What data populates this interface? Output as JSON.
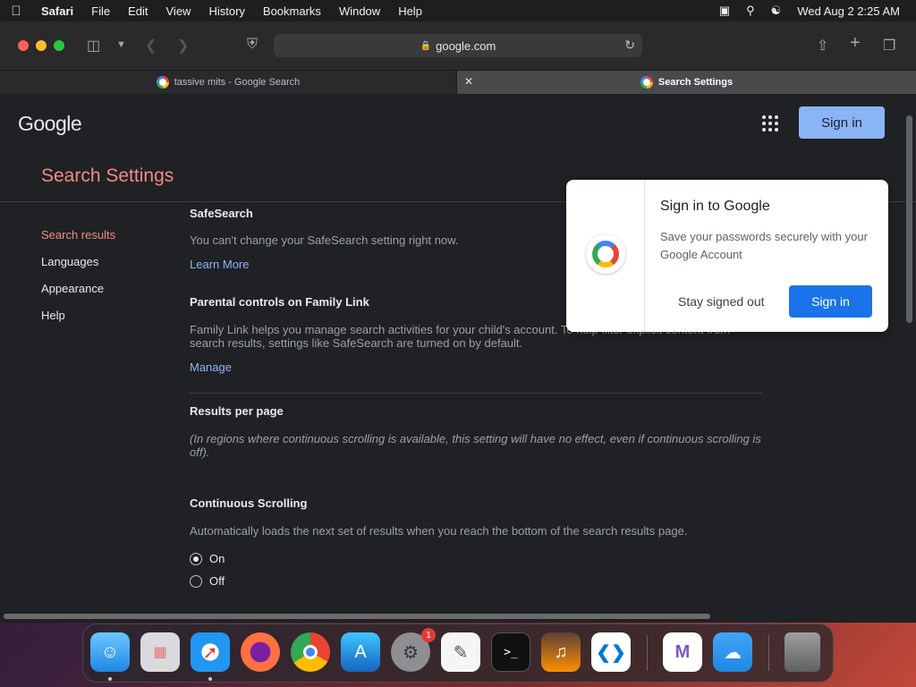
{
  "menubar": {
    "app": "Safari",
    "items": [
      "File",
      "Edit",
      "View",
      "History",
      "Bookmarks",
      "Window",
      "Help"
    ],
    "clock": "Wed Aug 2  2:25 AM"
  },
  "browser": {
    "address": "google.com",
    "tabs": [
      {
        "label": "tassive mits - Google Search",
        "active": false
      },
      {
        "label": "Search Settings",
        "active": true
      }
    ]
  },
  "page": {
    "logo": "Google",
    "signin_label": "Sign in",
    "title": "Search Settings",
    "nav": [
      "Search results",
      "Languages",
      "Appearance",
      "Help"
    ],
    "safesearch": {
      "heading": "SafeSearch",
      "text": "You can't change your SafeSearch setting right now.",
      "link": "Learn More"
    },
    "parental": {
      "heading": "Parental controls on Family Link",
      "text": "Family Link helps you manage search activities for your child's account. To help filter explicit content from search results, settings like SafeSearch are turned on by default.",
      "link": "Manage"
    },
    "results_per_page": {
      "heading": "Results per page",
      "text": "(In regions where continuous scrolling is available, this setting will have no effect, even if continuous scrolling is off)."
    },
    "continuous": {
      "heading": "Continuous Scrolling",
      "text": "Automatically loads the next set of results when you reach the bottom of the search results page.",
      "options": [
        "On",
        "Off"
      ],
      "selected": "On"
    }
  },
  "popup": {
    "title": "Sign in to Google",
    "desc": "Save your passwords securely with your Google Account",
    "stay": "Stay signed out",
    "signin": "Sign in"
  },
  "dock": {
    "badge_count": "1",
    "apps": [
      "finder-icon",
      "launchpad-icon",
      "safari-icon",
      "firefox-icon",
      "chrome-icon",
      "app-store-icon",
      "system-settings-icon",
      "textedit-icon",
      "terminal-icon",
      "garageband-icon",
      "vscode-icon",
      "visual-studio-icon",
      "weather-icon",
      "trash-icon"
    ]
  }
}
